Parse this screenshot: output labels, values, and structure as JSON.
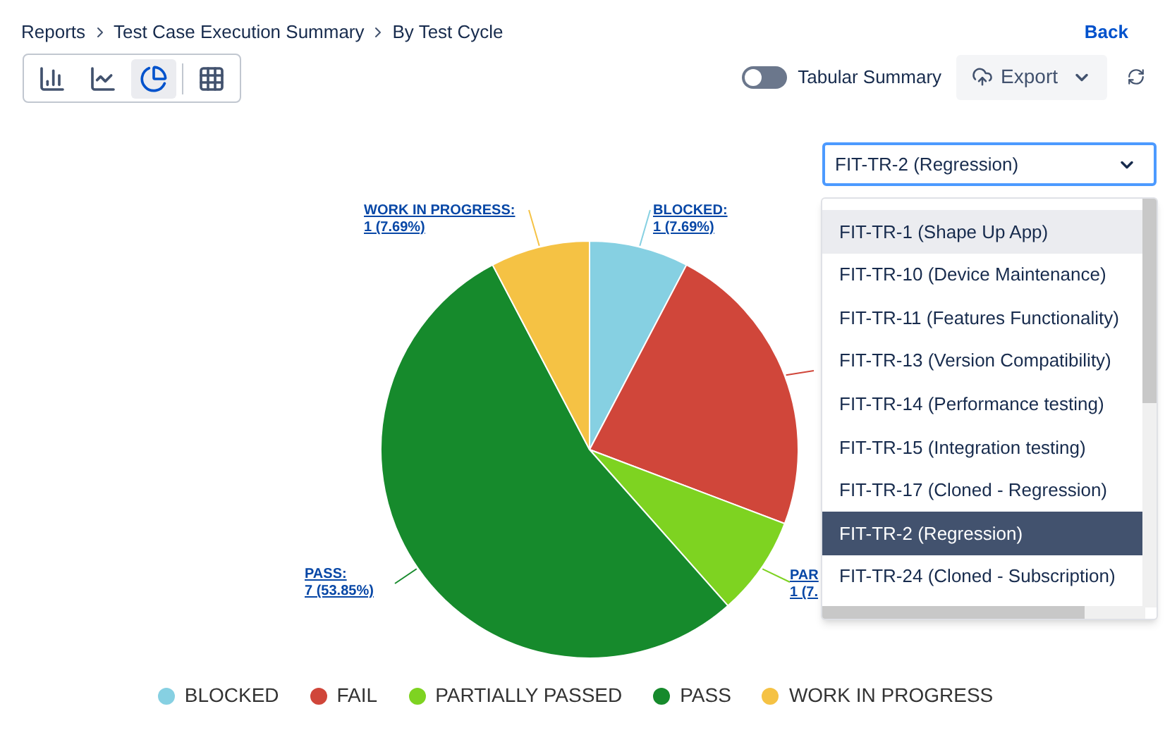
{
  "breadcrumb": [
    {
      "label": "Reports"
    },
    {
      "label": "Test Case Execution Summary"
    },
    {
      "label": "By Test Cycle"
    }
  ],
  "back_link": "Back",
  "chart_types": [
    {
      "kind": "bar",
      "selected": false
    },
    {
      "kind": "line",
      "selected": false
    },
    {
      "kind": "pie",
      "selected": true
    },
    {
      "kind": "table",
      "selected": false
    }
  ],
  "tabular_summary": {
    "label": "Tabular Summary",
    "on": false
  },
  "export_button": "Export",
  "cycle_select": {
    "value": "FIT-TR-2 (Regression)",
    "expanded": true,
    "options": [
      {
        "label": "FIT-TR-1 (Shape Up App)",
        "selected": false,
        "hovered": true
      },
      {
        "label": "FIT-TR-10 (Device Maintenance)",
        "selected": false,
        "hovered": false
      },
      {
        "label": "FIT-TR-11 (Features Functionality)",
        "selected": false,
        "hovered": false
      },
      {
        "label": "FIT-TR-13 (Version Compatibility)",
        "selected": false,
        "hovered": false
      },
      {
        "label": "FIT-TR-14 (Performance testing)",
        "selected": false,
        "hovered": false
      },
      {
        "label": "FIT-TR-15 (Integration testing)",
        "selected": false,
        "hovered": false
      },
      {
        "label": "FIT-TR-17 (Cloned - Regression)",
        "selected": false,
        "hovered": false
      },
      {
        "label": "FIT-TR-2 (Regression)",
        "selected": true,
        "hovered": false
      },
      {
        "label": "FIT-TR-24 (Cloned - Subscription)",
        "selected": false,
        "hovered": false
      }
    ]
  },
  "chart": {
    "chart_data": {
      "type": "pie",
      "categories": [
        "BLOCKED",
        "FAIL",
        "PARTIALLY PASSED",
        "PASS",
        "WORK IN PROGRESS"
      ],
      "series": [
        {
          "values": [
            7.69,
            23.08,
            7.69,
            53.85,
            7.69
          ]
        }
      ]
    },
    "slice_labels": [
      {
        "name": "BLOCKED:",
        "value": "1 (7.69%)"
      },
      {
        "name": "PAR",
        "value": "1 (7."
      },
      {
        "name": "PASS:",
        "value": "7 (53.85%)"
      },
      {
        "name": "WORK IN PROGRESS:",
        "value": "1 (7.69%)"
      }
    ],
    "legend": [
      {
        "color": "#86d0e2"
      },
      {
        "color": "#d0463a"
      },
      {
        "color": "#7ed321"
      },
      {
        "color": "#168a2c"
      },
      {
        "color": "#f5c244"
      }
    ]
  }
}
